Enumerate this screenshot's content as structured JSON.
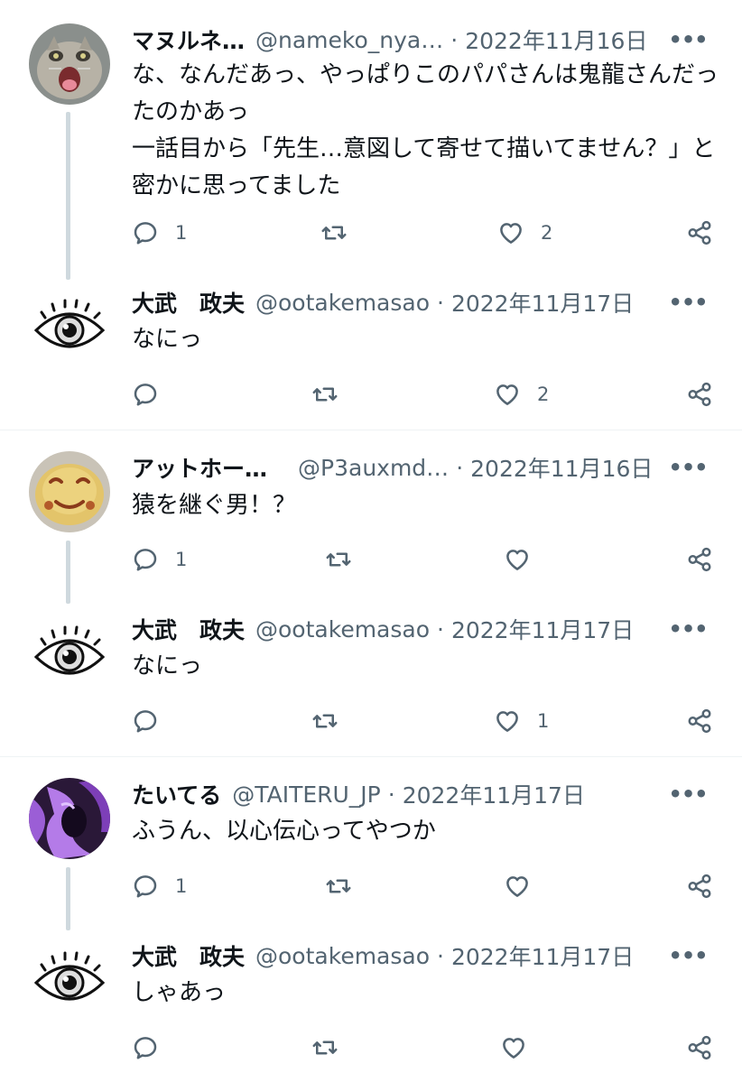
{
  "colors": {
    "text": "#0f1419",
    "muted": "#536471",
    "thread_line": "#cfd9de",
    "divider": "#eff3f4"
  },
  "tweets": [
    {
      "avatar_icon": "cat-photo-avatar",
      "name": "マヌルネ…",
      "handle": "@nameko_nya…",
      "date": "2022年11月16日",
      "text": "な、なんだあっ、やっぱりこのパパさんは鬼龍さんだったのかあっ\n一話目から「先生…意図して寄せて描いてません？」と密かに思ってました",
      "replies": "1",
      "retweets": "",
      "likes": "2",
      "more_icon": "more-icon"
    },
    {
      "avatar_icon": "eye-avatar",
      "name": "大武　政夫",
      "handle": "@ootakemasao",
      "date": "2022年11月17日",
      "text": "なにっ",
      "replies": "",
      "retweets": "",
      "likes": "2"
    },
    {
      "avatar_icon": "bread-photo-avatar",
      "name": "アットホー…",
      "handle": "@P3auxmd…",
      "date": "2022年11月16日",
      "text": "猿を継ぐ男！？",
      "replies": "1",
      "retweets": "",
      "likes": ""
    },
    {
      "avatar_icon": "eye-avatar",
      "name": "大武　政夫",
      "handle": "@ootakemasao",
      "date": "2022年11月17日",
      "text": "なにっ",
      "replies": "",
      "retweets": "",
      "likes": "1"
    },
    {
      "avatar_icon": "purple-photo-avatar",
      "name": "たいてる",
      "handle": "@TAITERU_JP",
      "date": "2022年11月17日",
      "text": "ふうん、以心伝心ってやつか",
      "replies": "1",
      "retweets": "",
      "likes": ""
    },
    {
      "avatar_icon": "eye-avatar",
      "name": "大武　政夫",
      "handle": "@ootakemasao",
      "date": "2022年11月17日",
      "text": "しゃあっ",
      "replies": "",
      "retweets": "",
      "likes": ""
    }
  ],
  "separator": "·"
}
